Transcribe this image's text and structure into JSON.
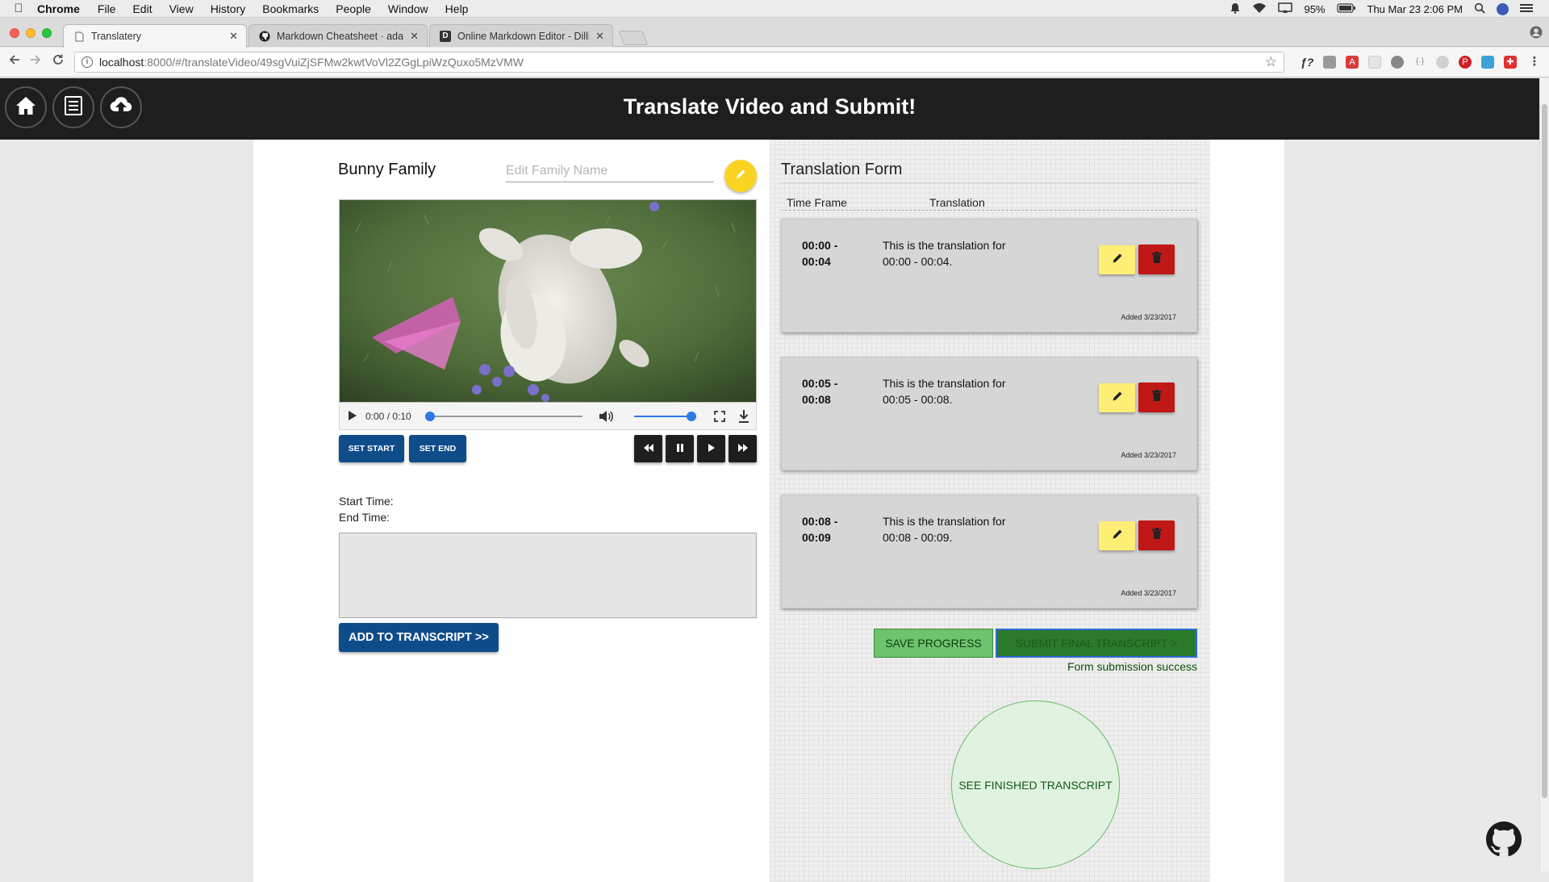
{
  "menubar": {
    "app_name": "Chrome",
    "items": [
      "File",
      "Edit",
      "View",
      "History",
      "Bookmarks",
      "People",
      "Window",
      "Help"
    ],
    "battery": "95%",
    "clock": "Thu Mar 23  2:06 PM"
  },
  "tabs": [
    {
      "title": "Translatery",
      "favicon": "page-icon",
      "active": true
    },
    {
      "title": "Markdown Cheatsheet · adam-p/markdown-here Wiki",
      "favicon": "github-icon",
      "active": false
    },
    {
      "title": "Online Markdown Editor - Dillinger",
      "favicon": "dillinger-icon",
      "active": false
    }
  ],
  "address": {
    "host": "localhost",
    "path": ":8000/#/translateVideo/49sgVuiZjSFMw2kwtVoVl2ZGgLpiWzQuxo5MzVMW"
  },
  "header": {
    "title": "Translate Video and Submit!",
    "buttons": [
      "home-icon",
      "list-icon",
      "cloud-upload-icon"
    ]
  },
  "family": {
    "name": "Bunny Family",
    "edit_placeholder": "Edit Family Name"
  },
  "video": {
    "time": "0:00 / 0:10",
    "progress": 0,
    "volume": 1
  },
  "buttons": {
    "set_start": "SET START",
    "set_end": "SET END",
    "add_transcript": "ADD TO TRANSCRIPT >>",
    "save_progress": "SAVE PROGRESS",
    "submit_final": "SUBMIT FINAL TRANSCRIPT  >",
    "see_finished": "SEE FINISHED TRANSCRIPT"
  },
  "times": {
    "start_label": "Start Time:",
    "end_label": "End Time:"
  },
  "form": {
    "title": "Translation Form",
    "col_time": "Time Frame",
    "col_translation": "Translation",
    "entries": [
      {
        "start": "00:00 -",
        "end": "00:04",
        "text1": "This is the translation for",
        "text2": "00:00 - 00:04.",
        "added": "Added 3/23/2017"
      },
      {
        "start": "00:05 -",
        "end": "00:08",
        "text1": "This is the translation for",
        "text2": "00:05 - 00:08.",
        "added": "Added 3/23/2017"
      },
      {
        "start": "00:08 -",
        "end": "00:09",
        "text1": "This is the translation for",
        "text2": "00:08 - 00:09.",
        "added": "Added 3/23/2017"
      }
    ],
    "status": "Form submission success"
  },
  "colors": {
    "header": "#1e1e1e",
    "primary_blue": "#0f4c8a",
    "edit_yellow": "#ffee75",
    "delete_red": "#c01717",
    "success_green": "#6ec46e"
  }
}
